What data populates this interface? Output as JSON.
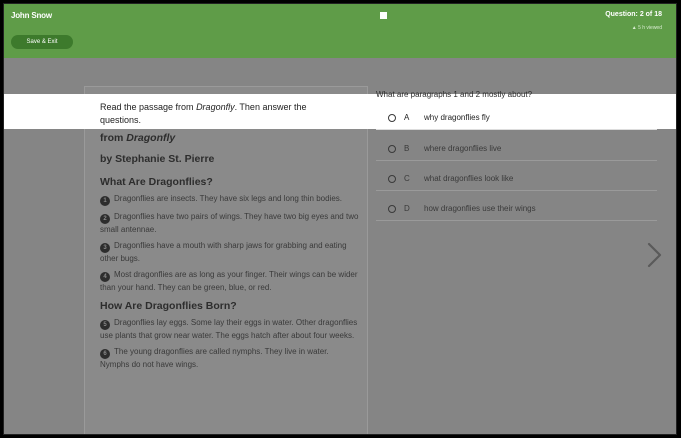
{
  "header": {
    "student_name": "John Snow",
    "save_exit_label": "Save & Exit",
    "question_count": "Question: 2 of 18",
    "question_status": "▲ 5 h viewed"
  },
  "passage": {
    "prompt_before": "Read the passage from ",
    "prompt_title": "Dragonfly",
    "prompt_after": ". Then answer the questions.",
    "from_label": "from Dragonfly",
    "author": "by Stephanie St. Pierre",
    "heading1": "What Are Dragonflies?",
    "paragraphs1": [
      {
        "num": "1",
        "text": "Dragonflies are insects. They have six legs and long thin bodies."
      },
      {
        "num": "2",
        "text": "Dragonflies have two pairs of wings. They have two big eyes and two small antennae."
      },
      {
        "num": "3",
        "text": "Dragonflies have a mouth with sharp jaws for grabbing and eating other bugs."
      },
      {
        "num": "4",
        "text": "Most dragonflies are as long as your finger. Their wings can be wider than your hand. They can be green, blue, or red."
      }
    ],
    "heading2": "How Are Dragonflies Born?",
    "paragraphs2": [
      {
        "num": "5",
        "text": "Dragonflies lay eggs. Some lay their eggs in water. Other dragonflies use plants that grow near water. The eggs hatch after about four weeks."
      },
      {
        "num": "6",
        "text": "The young dragonflies are called nymphs. They live in water. Nymphs do not have wings."
      }
    ]
  },
  "question": {
    "stem": "What are paragraphs 1 and 2 mostly about?",
    "answers": [
      {
        "letter": "A",
        "text": "why dragonflies fly"
      },
      {
        "letter": "B",
        "text": "where dragonflies live"
      },
      {
        "letter": "C",
        "text": "what dragonflies look like"
      },
      {
        "letter": "D",
        "text": "how dragonflies use their wings"
      }
    ],
    "next_icon": "chevron-right-icon"
  },
  "colors": {
    "header_green": "#5f9c48",
    "button_green": "#3d7a2c",
    "dim_overlay": "#858585"
  }
}
